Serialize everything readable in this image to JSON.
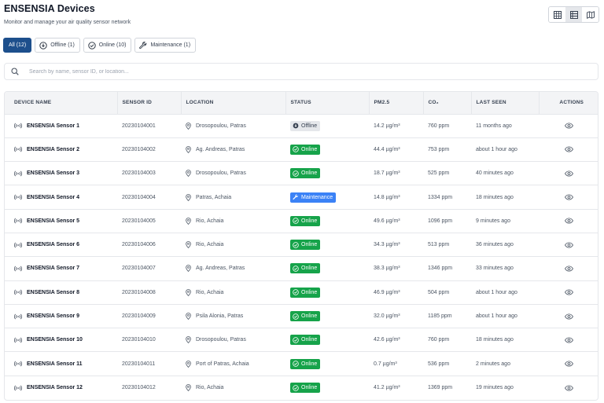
{
  "header": {
    "title": "ENSENSIA Devices",
    "subtitle": "Monitor and manage your air quality sensor network"
  },
  "view_switch": [
    {
      "icon": "grid-icon",
      "active": false
    },
    {
      "icon": "list-icon",
      "active": true
    },
    {
      "icon": "map-icon",
      "active": false
    }
  ],
  "filters": {
    "all": "All (12)",
    "offline": "Offline (1)",
    "online": "Online (10)",
    "maintenance": "Maintenance (1)"
  },
  "search": {
    "placeholder": "Search by name, sensor ID, or location...",
    "value": ""
  },
  "table": {
    "columns": [
      "DEVICE NAME",
      "SENSOR ID",
      "LOCATION",
      "STATUS",
      "PM2.5",
      "CO₂",
      "LAST SEEN",
      "ACTIONS"
    ],
    "rows": [
      {
        "name": "ENSENSIA Sensor 1",
        "sensor_id": "20230104001",
        "location": "Drosopoulou, Patras",
        "status": "Offline",
        "pm25": "14.2 µg/m³",
        "co2": "760 ppm",
        "last_seen": "11 months ago"
      },
      {
        "name": "ENSENSIA Sensor 2",
        "sensor_id": "20230104002",
        "location": "Ag. Andreas, Patras",
        "status": "Online",
        "pm25": "44.4 µg/m³",
        "co2": "753 ppm",
        "last_seen": "about 1 hour ago"
      },
      {
        "name": "ENSENSIA Sensor 3",
        "sensor_id": "20230104003",
        "location": "Drosopoulou, Patras",
        "status": "Online",
        "pm25": "18.7 µg/m³",
        "co2": "525 ppm",
        "last_seen": "40 minutes ago"
      },
      {
        "name": "ENSENSIA Sensor 4",
        "sensor_id": "20230104004",
        "location": "Patras, Achaia",
        "status": "Maintenance",
        "pm25": "14.8 µg/m³",
        "co2": "1334 ppm",
        "last_seen": "18 minutes ago"
      },
      {
        "name": "ENSENSIA Sensor 5",
        "sensor_id": "20230104005",
        "location": "Rio, Achaia",
        "status": "Online",
        "pm25": "49.6 µg/m³",
        "co2": "1096 ppm",
        "last_seen": "9 minutes ago"
      },
      {
        "name": "ENSENSIA Sensor 6",
        "sensor_id": "20230104006",
        "location": "Rio, Achaia",
        "status": "Online",
        "pm25": "34.3 µg/m³",
        "co2": "513 ppm",
        "last_seen": "36 minutes ago"
      },
      {
        "name": "ENSENSIA Sensor 7",
        "sensor_id": "20230104007",
        "location": "Ag. Andreas, Patras",
        "status": "Online",
        "pm25": "38.3 µg/m³",
        "co2": "1346 ppm",
        "last_seen": "33 minutes ago"
      },
      {
        "name": "ENSENSIA Sensor 8",
        "sensor_id": "20230104008",
        "location": "Rio, Achaia",
        "status": "Online",
        "pm25": "46.9 µg/m³",
        "co2": "504 ppm",
        "last_seen": "about 1 hour ago"
      },
      {
        "name": "ENSENSIA Sensor 9",
        "sensor_id": "20230104009",
        "location": "Psila Alonia, Patras",
        "status": "Online",
        "pm25": "32.0 µg/m³",
        "co2": "1185 ppm",
        "last_seen": "about 1 hour ago"
      },
      {
        "name": "ENSENSIA Sensor 10",
        "sensor_id": "20230104010",
        "location": "Drosopoulou, Patras",
        "status": "Online",
        "pm25": "42.6 µg/m³",
        "co2": "760 ppm",
        "last_seen": "18 minutes ago"
      },
      {
        "name": "ENSENSIA Sensor 11",
        "sensor_id": "20230104011",
        "location": "Port of Patras, Achaia",
        "status": "Online",
        "pm25": "0.7 µg/m³",
        "co2": "536 ppm",
        "last_seen": "2 minutes ago"
      },
      {
        "name": "ENSENSIA Sensor 12",
        "sensor_id": "20230104012",
        "location": "Rio, Achaia",
        "status": "Online",
        "pm25": "41.2 µg/m³",
        "co2": "1369 ppm",
        "last_seen": "19 minutes ago"
      }
    ]
  },
  "colors": {
    "primary": "#1d4f8c",
    "online": "#16a34a",
    "offline": "#e5e7eb",
    "maintenance": "#3b82f6"
  }
}
